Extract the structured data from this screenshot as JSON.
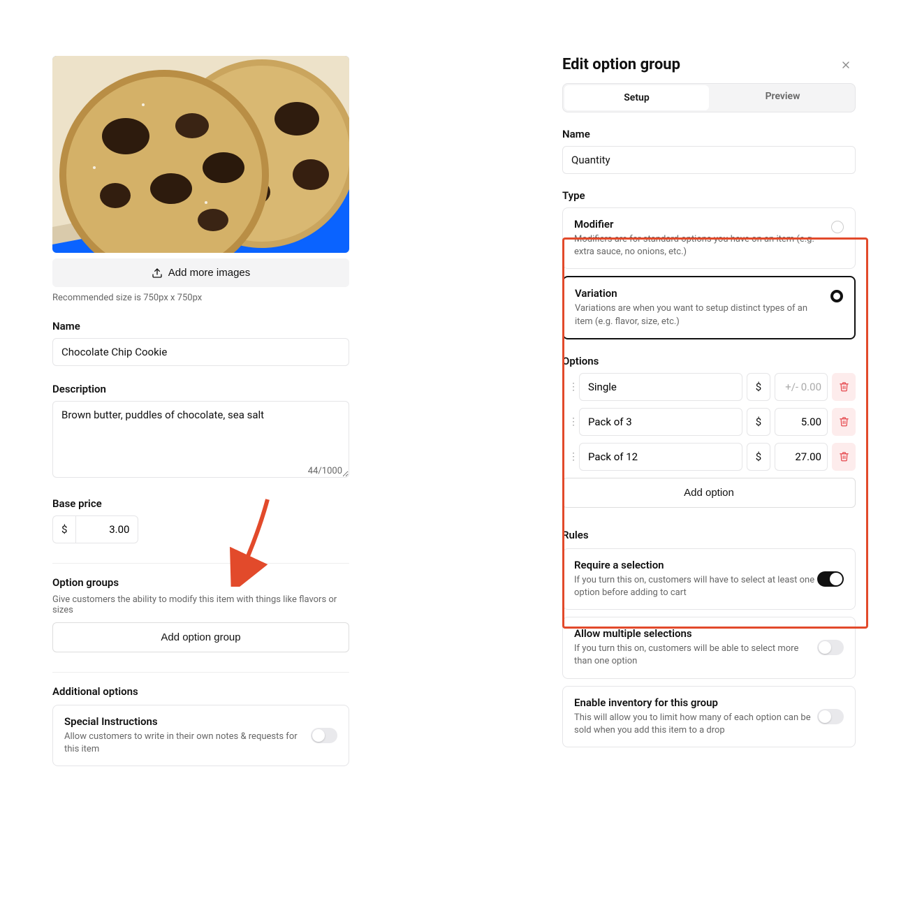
{
  "left": {
    "add_images": "Add more images",
    "img_hint": "Recommended size is 750px x 750px",
    "name_label": "Name",
    "name_value": "Chocolate Chip Cookie",
    "desc_label": "Description",
    "desc_value": "Brown butter, puddles of chocolate, sea salt",
    "desc_count": "44/1000",
    "price_label": "Base price",
    "currency": "$",
    "price_value": "3.00",
    "option_groups_label": "Option groups",
    "option_groups_hint": "Give customers the ability to modify this item with things like flavors or sizes",
    "add_option_group": "Add option group",
    "additional_label": "Additional options",
    "special": {
      "title": "Special Instructions",
      "desc": "Allow customers to write in their own notes & requests for this item",
      "on": false
    }
  },
  "right": {
    "title": "Edit option group",
    "tabs": {
      "setup": "Setup",
      "preview": "Preview"
    },
    "name_label": "Name",
    "name_value": "Quantity",
    "type_label": "Type",
    "types": {
      "modifier": {
        "title": "Modifier",
        "desc": "Modifiers are for standard options you have on an item (e.g. extra sauce, no onions, etc.)"
      },
      "variation": {
        "title": "Variation",
        "desc": "Variations are when you want to setup distinct types of an item (e.g. flavor, size, etc.)"
      }
    },
    "options_label": "Options",
    "currency": "$",
    "price_placeholder": "+/- 0.00",
    "options": [
      {
        "name": "Single",
        "price": ""
      },
      {
        "name": "Pack of 3",
        "price": "5.00"
      },
      {
        "name": "Pack of 12",
        "price": "27.00"
      }
    ],
    "add_option": "Add option",
    "rules_label": "Rules",
    "rules": {
      "require": {
        "title": "Require a selection",
        "desc": "If you turn this on, customers will have to select at least one option before adding to cart",
        "on": true
      },
      "multi": {
        "title": "Allow multiple selections",
        "desc": "If you turn this on, customers will be able to select more than one option",
        "on": false
      },
      "inventory": {
        "title": "Enable inventory for this group",
        "desc": "This will allow you to limit how many of each option can be sold when you add this item to a drop",
        "on": false
      }
    }
  }
}
